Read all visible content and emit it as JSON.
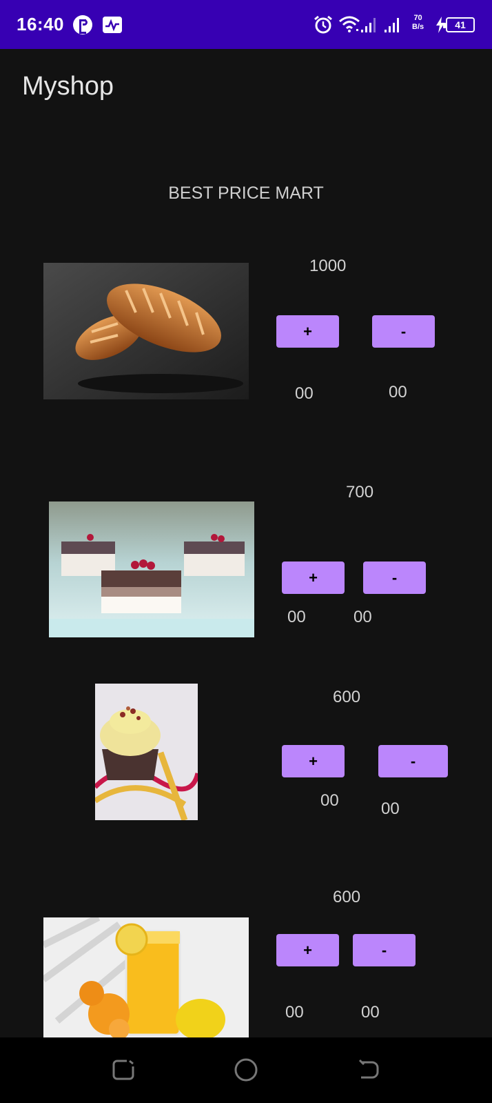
{
  "status_bar": {
    "time": "16:40",
    "speed_value": "70",
    "speed_unit": "B/s",
    "battery": "41",
    "icons": [
      "notification-app-icon",
      "activity-icon",
      "alarm-icon",
      "wifi-icon",
      "signal-icon",
      "signal-icon",
      "charging-icon",
      "battery-icon"
    ]
  },
  "app": {
    "title": "Myshop"
  },
  "store": {
    "title": "BEST PRICE MART"
  },
  "products": [
    {
      "name": "bread",
      "price": "1000",
      "plus_label": "+",
      "minus_label": "-",
      "qty_left": "00",
      "qty_right": "00"
    },
    {
      "name": "cake",
      "price": "700",
      "plus_label": "+",
      "minus_label": "-",
      "qty_left": "00",
      "qty_right": "00"
    },
    {
      "name": "cupcake",
      "price": "600",
      "plus_label": "+",
      "minus_label": "-",
      "qty_left": "00",
      "qty_right": "00"
    },
    {
      "name": "juice",
      "price": "600",
      "plus_label": "+",
      "minus_label": "-",
      "qty_left": "00",
      "qty_right": "00"
    }
  ],
  "nav": {
    "icons": [
      "recents-icon",
      "home-icon",
      "back-icon"
    ]
  },
  "colors": {
    "status_bar": "#3700b3",
    "button": "#bb86fc",
    "background": "#121212"
  }
}
